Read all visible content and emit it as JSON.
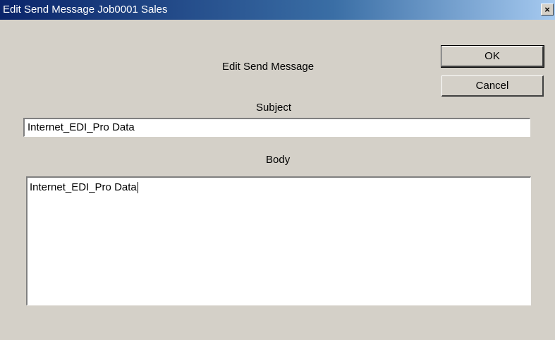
{
  "window": {
    "title": "Edit Send Message Job0001 Sales",
    "close_glyph": "×"
  },
  "dialog": {
    "heading": "Edit Send Message"
  },
  "buttons": {
    "ok_label": "OK",
    "cancel_label": "Cancel"
  },
  "subject": {
    "label": "Subject",
    "value": "Internet_EDI_Pro Data"
  },
  "body": {
    "label": "Body",
    "value": "Internet_EDI_Pro Data"
  },
  "colors": {
    "title_bar_start": "#0a246a",
    "title_bar_end": "#a6caf0",
    "dialog_face": "#d4d0c8"
  }
}
